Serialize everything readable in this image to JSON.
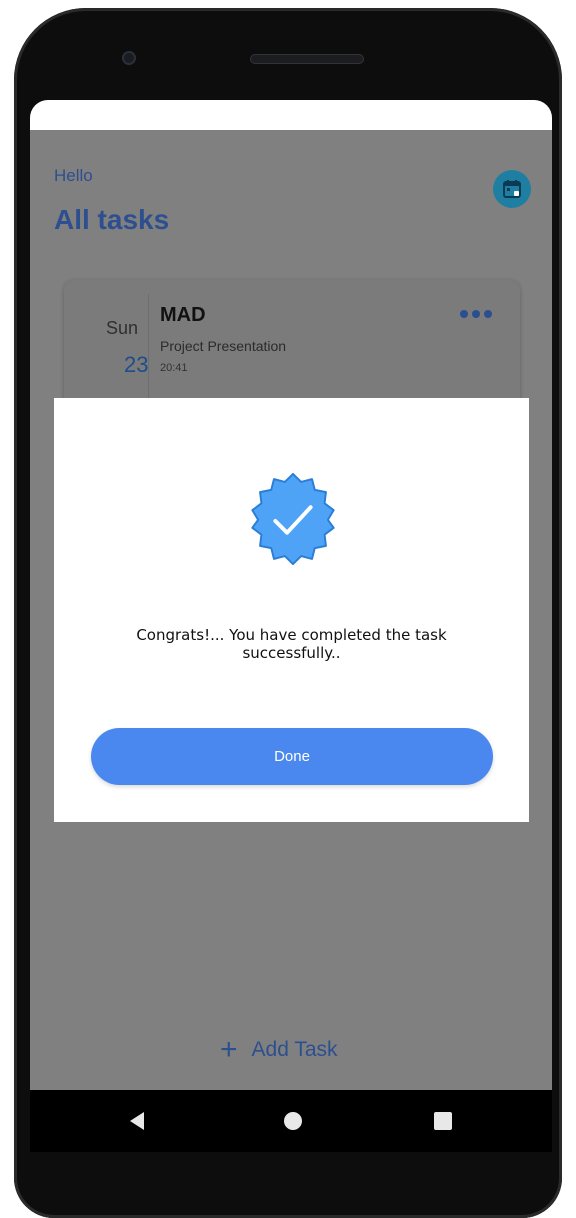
{
  "header": {
    "greeting": "Hello",
    "title": "All tasks"
  },
  "task": {
    "day": "Sun",
    "date": "23",
    "title": "MAD",
    "description": "Project Presentation",
    "time": "20:41"
  },
  "footer": {
    "add_icon": "+",
    "add_label": "Add Task"
  },
  "dialog": {
    "message_line1": "Congrats!... You have completed the task",
    "message_line2": "successfully..",
    "done_label": "Done",
    "badge_icon": "verified-badge-icon"
  },
  "colors": {
    "accent": "#4a87ee",
    "badge": "#4fa3f7",
    "title": "#2d4f8f",
    "overlay": "#808080"
  }
}
